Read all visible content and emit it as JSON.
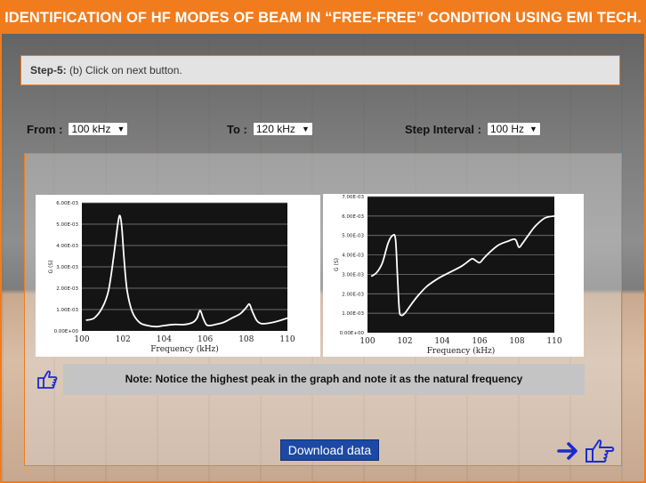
{
  "header": {
    "title": "IDENTIFICATION OF HF MODES OF BEAM IN “FREE-FREE” CONDITION USING EMI TECH."
  },
  "step": {
    "label": "Step-5:",
    "text": " (b) Click on next button."
  },
  "controls": {
    "from_label": "From :",
    "from_value": "100 kHz",
    "to_label": "To :",
    "to_value": "120 kHz",
    "step_label": "Step Interval :",
    "step_value": "100 Hz"
  },
  "note": {
    "text": "Note: Notice the highest peak in the graph and note it as the natural frequency"
  },
  "download": {
    "label": "Download data"
  },
  "icons": {
    "pointer": "hand-pointer-icon",
    "next_arrow": "arrow-right-icon",
    "next_hand": "hand-pointer-right-icon"
  },
  "colors": {
    "accent": "#f07c1e",
    "button": "#1d49a5",
    "arrow": "#1a2bd1"
  },
  "chart_data": [
    {
      "type": "line",
      "ylabel": "G (S)",
      "xlabel": "Frequency (kHz)",
      "ylim": [
        0,
        0.006
      ],
      "xlim": [
        100,
        110
      ],
      "yticks": [
        "0.00E+00",
        "1.00E-03",
        "2.00E-03",
        "3.00E-03",
        "4.00E-03",
        "5.00E-03",
        "6.00E-03"
      ],
      "xticks": [
        "100",
        "102",
        "104",
        "106",
        "108",
        "110"
      ],
      "grid": true,
      "x": [
        100.2,
        100.6,
        101.0,
        101.3,
        101.55,
        101.75,
        101.85,
        101.95,
        102.05,
        102.2,
        102.45,
        102.8,
        103.2,
        103.6,
        104.0,
        104.5,
        105.0,
        105.4,
        105.6,
        105.75,
        105.9,
        106.05,
        106.2,
        106.5,
        106.9,
        107.3,
        107.7,
        108.0,
        108.15,
        108.3,
        108.5,
        108.7,
        109.0,
        109.5,
        110.0
      ],
      "y": [
        0.0005,
        0.0006,
        0.0011,
        0.0019,
        0.0035,
        0.005,
        0.0054,
        0.0048,
        0.0034,
        0.0019,
        0.0009,
        0.0004,
        0.00025,
        0.0002,
        0.00025,
        0.0003,
        0.0003,
        0.0004,
        0.0006,
        0.00095,
        0.0006,
        0.0003,
        0.00025,
        0.0003,
        0.0004,
        0.0006,
        0.0008,
        0.0011,
        0.00125,
        0.0009,
        0.0005,
        0.00035,
        0.00035,
        0.00045,
        0.0006
      ]
    },
    {
      "type": "line",
      "ylabel": "G (S)",
      "xlabel": "Frequency (kHz)",
      "ylim": [
        0,
        0.007
      ],
      "xlim": [
        100,
        110
      ],
      "yticks": [
        "0.00E+00",
        "1.00E-03",
        "2.00E-03",
        "3.00E-03",
        "4.00E-03",
        "5.00E-03",
        "6.00E-03",
        "7.00E-03"
      ],
      "xticks": [
        "100",
        "102",
        "104",
        "106",
        "108",
        "110"
      ],
      "grid": true,
      "x": [
        100.2,
        100.5,
        100.8,
        101.1,
        101.35,
        101.5,
        101.6,
        101.7,
        101.8,
        102.0,
        102.3,
        102.7,
        103.2,
        103.8,
        104.4,
        105.0,
        105.3,
        105.6,
        105.8,
        106.0,
        106.2,
        106.5,
        107.0,
        107.5,
        107.9,
        108.1,
        108.3,
        108.6,
        109.0,
        109.5,
        110.0
      ],
      "y": [
        0.0029,
        0.0031,
        0.0036,
        0.0046,
        0.005,
        0.0048,
        0.003,
        0.0012,
        0.0009,
        0.001,
        0.0014,
        0.0019,
        0.0024,
        0.0028,
        0.0031,
        0.0034,
        0.0036,
        0.0038,
        0.0037,
        0.0036,
        0.0038,
        0.0041,
        0.0045,
        0.0047,
        0.0048,
        0.0044,
        0.0046,
        0.005,
        0.0055,
        0.0059,
        0.006
      ]
    }
  ]
}
